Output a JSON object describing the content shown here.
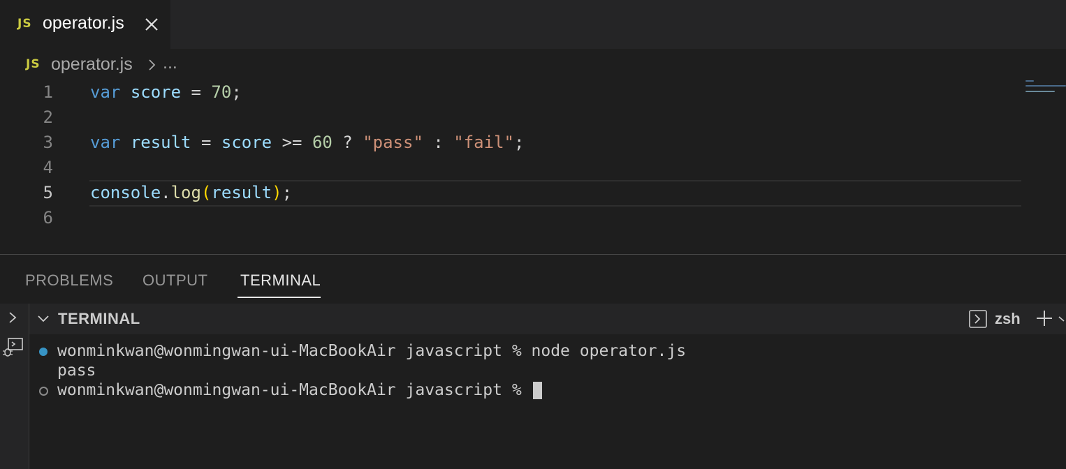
{
  "tab": {
    "icon": "JS",
    "label": "operator.js"
  },
  "breadcrumb": {
    "icon": "JS",
    "file": "operator.js",
    "more": "..."
  },
  "editor": {
    "active_line": 5,
    "lines": [
      {
        "number": "1"
      },
      {
        "number": "2"
      },
      {
        "number": "3"
      },
      {
        "number": "4"
      },
      {
        "number": "5"
      },
      {
        "number": "6"
      }
    ],
    "code": {
      "line1": {
        "kw": "var",
        "name": "score",
        "eq": "=",
        "value": "70",
        "semi": ";"
      },
      "line3": {
        "kw": "var",
        "name": "result",
        "eq": "=",
        "ref": "score",
        "cmp": ">=",
        "num": "60",
        "q": "?",
        "pass": "\"pass\"",
        "colon": ":",
        "fail": "\"fail\"",
        "semi": ";"
      },
      "line5": {
        "obj": "console",
        "dot": ".",
        "fn": "log",
        "open": "(",
        "arg": "result",
        "close": ")",
        "semi": ";"
      }
    }
  },
  "panel": {
    "tabs": [
      "PROBLEMS",
      "OUTPUT",
      "TERMINAL"
    ],
    "active_tab": "TERMINAL",
    "section_title": "TERMINAL",
    "shell": "zsh"
  },
  "terminal": {
    "lines": [
      {
        "text": "wonminkwan@wonmingwan-ui-MacBookAir javascript % node operator.js",
        "marker": "filled"
      },
      {
        "text": "pass",
        "marker": "none"
      },
      {
        "text": "wonminkwan@wonmingwan-ui-MacBookAir javascript % ",
        "marker": "hollow"
      }
    ]
  },
  "colors": {
    "js_badge": "#cbcb41",
    "keyword": "#569cd6",
    "variable": "#9cdcfe",
    "number": "#b5cea8",
    "string": "#ce9178",
    "function": "#dcdcaa",
    "bracket": "#ffd700",
    "dot_success": "#3794c5"
  },
  "icons": {
    "tab_close": "close-icon",
    "breadcrumb_sep": "chevron-right-icon",
    "section_toggle": "chevron-down-icon",
    "side_expand": "chevron-right-icon",
    "side_debug": "debug-console-icon",
    "terminal_shell": "terminal-icon",
    "new_terminal": "plus-icon",
    "terminal_dropdown": "chevron-down-icon"
  }
}
